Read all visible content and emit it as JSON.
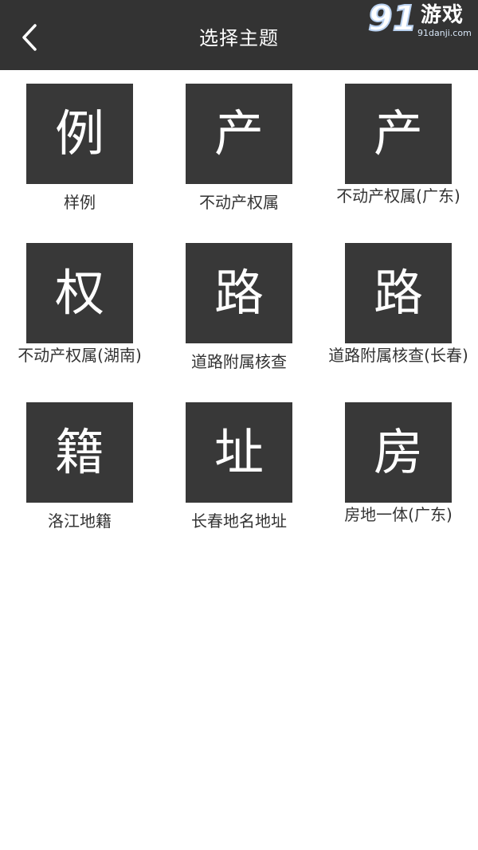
{
  "header": {
    "title": "选择主题",
    "back_icon": "chevron-left-icon"
  },
  "watermark": {
    "logo_number": "91",
    "logo_text": "游戏",
    "url": "91danji.com"
  },
  "themes": [
    {
      "glyph": "例",
      "label": "样例"
    },
    {
      "glyph": "产",
      "label": "不动产权属"
    },
    {
      "glyph": "产",
      "label": "不动产权属(广东)"
    },
    {
      "glyph": "权",
      "label": "不动产权属(湖南)"
    },
    {
      "glyph": "路",
      "label": "道路附属核查"
    },
    {
      "glyph": "路",
      "label": "道路附属核查(长春)"
    },
    {
      "glyph": "籍",
      "label": "洛江地籍"
    },
    {
      "glyph": "址",
      "label": "长春地名地址"
    },
    {
      "glyph": "房",
      "label": "房地一体(广东)"
    }
  ],
  "colors": {
    "header_bg": "#333333",
    "tile_bg": "#383838",
    "label_text": "#333333"
  }
}
